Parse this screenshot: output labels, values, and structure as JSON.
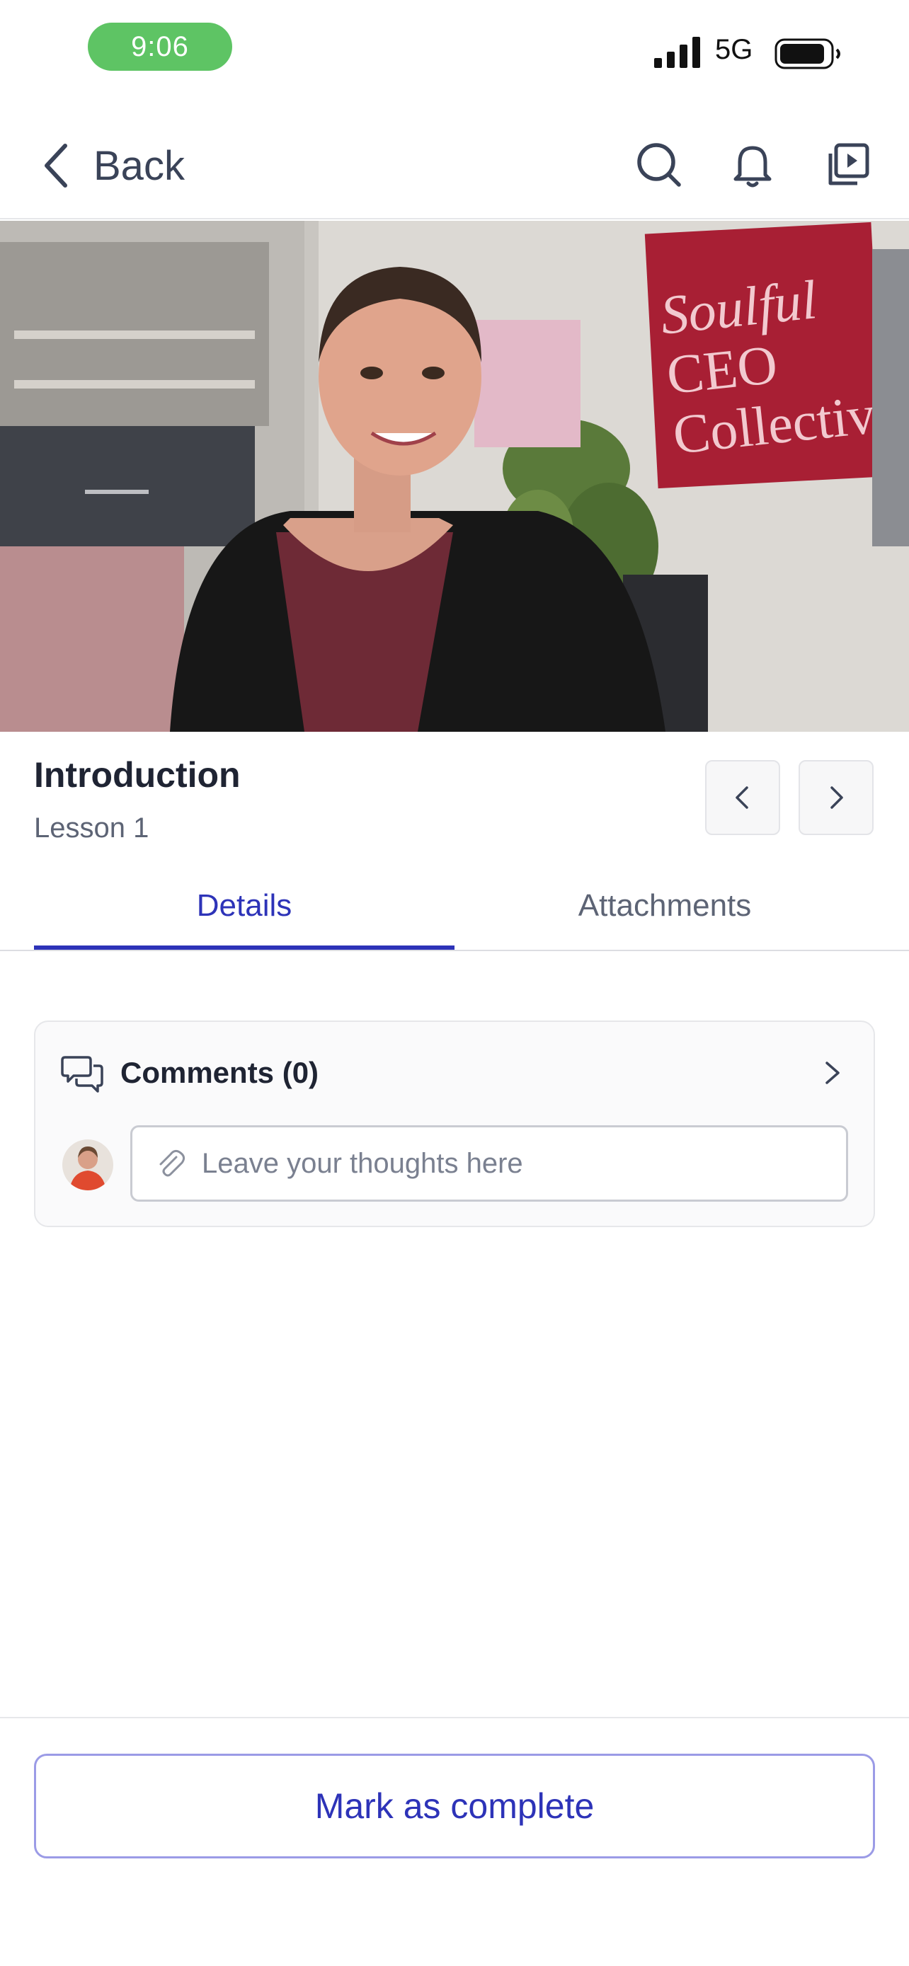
{
  "status_bar": {
    "time": "9:06",
    "network": "5G",
    "icons": [
      "signal-bars-icon",
      "battery-icon"
    ],
    "time_pill_color": "#5ec464"
  },
  "nav": {
    "back_label": "Back",
    "icons": [
      "search-icon",
      "bell-icon",
      "video-library-icon"
    ]
  },
  "video": {
    "poster_sign_text": [
      "Soulful",
      "CEO",
      "Collective."
    ]
  },
  "lesson": {
    "title": "Introduction",
    "subtitle": "Lesson 1",
    "prev_icon": "chevron-left-icon",
    "next_icon": "chevron-right-icon"
  },
  "tabs": [
    {
      "label": "Details",
      "active": true
    },
    {
      "label": "Attachments",
      "active": false
    }
  ],
  "comments": {
    "label": "Comments (0)",
    "input_placeholder": "Leave your thoughts here",
    "input_value": "",
    "icons": [
      "comments-icon",
      "chevron-right-icon",
      "paperclip-icon",
      "avatar"
    ]
  },
  "footer": {
    "complete_label": "Mark as complete"
  },
  "colors": {
    "accent": "#2d33b8",
    "accent_border": "#9b9be6",
    "text_primary": "#1f2433",
    "text_secondary": "#5d6475"
  }
}
